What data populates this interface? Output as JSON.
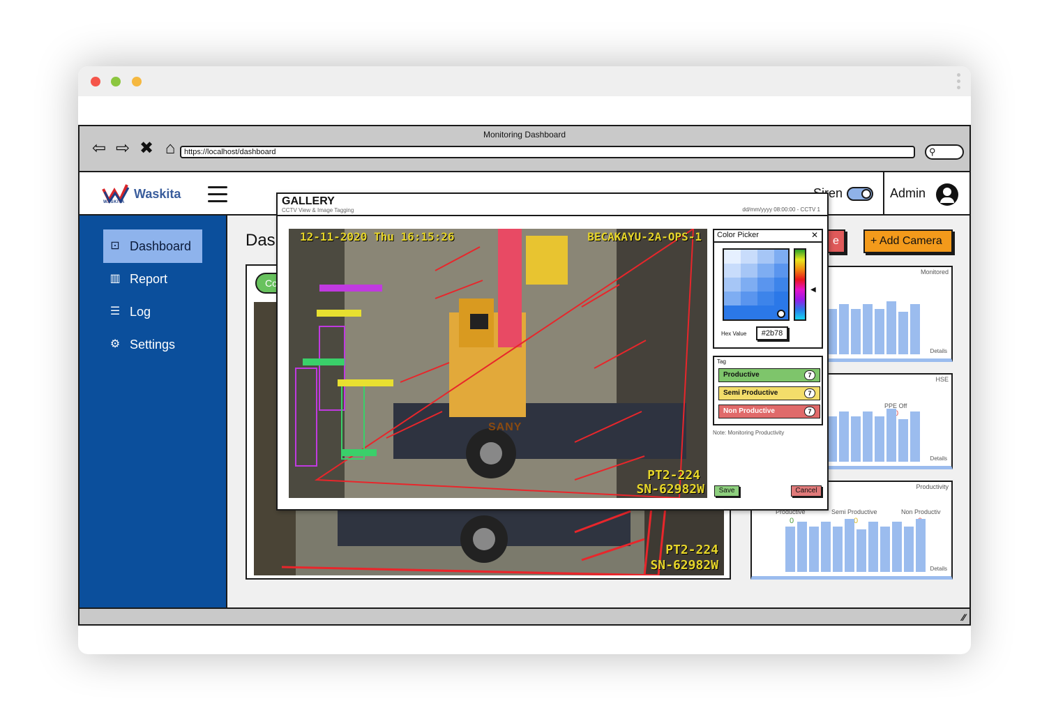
{
  "browser": {
    "window_title": "Monitoring Dashboard",
    "url": "https://localhost/dashboard",
    "nav_icons": [
      "back-icon",
      "forward-icon",
      "close-icon",
      "home-icon"
    ]
  },
  "app": {
    "brand": "Waskita",
    "brand_sub": "WASKITA",
    "siren_label": "Siren",
    "siren_on": true,
    "user": "Admin"
  },
  "sidebar": {
    "items": [
      {
        "label": "Dashboard",
        "icon": "chart-icon",
        "active": true
      },
      {
        "label": "Report",
        "icon": "report-icon",
        "active": false
      },
      {
        "label": "Log",
        "icon": "list-icon",
        "active": false
      },
      {
        "label": "Settings",
        "icon": "gear-icon",
        "active": false
      }
    ]
  },
  "main": {
    "title": "Das",
    "camera_tab_label": "Cc",
    "add_camera_label": "+ Add Camera",
    "red_button_label": "e",
    "camera_osd": {
      "bottom1": "PT2-224",
      "bottom2": "SN-62982W"
    }
  },
  "panels": [
    {
      "title": "Monitored",
      "details": "Details",
      "bars": [
        0.85,
        0.95,
        0.85,
        0.95,
        0.85,
        1.0,
        0.8,
        0.95
      ]
    },
    {
      "title": "HSE",
      "details": "Details",
      "label": "PPE Off",
      "label_value": "0",
      "bars": [
        0.85,
        0.95,
        0.85,
        0.95,
        0.85,
        1.0,
        0.8,
        0.95
      ]
    },
    {
      "title": "Productivity",
      "details": "Details",
      "labels": [
        "Productive",
        "Semi Productive",
        "Non Productiv"
      ],
      "label_values": [
        "0",
        "0",
        "0"
      ],
      "bars": [
        0.85,
        0.95,
        0.85,
        0.95,
        0.85,
        1.0,
        0.8,
        0.95,
        0.85,
        0.95,
        0.85,
        1.0
      ]
    }
  ],
  "modal": {
    "title": "GALLERY",
    "subtitle": "CCTV View & Image Tagging",
    "meta": "dd/mm/yyyy 08:00:00 - CCTV 1",
    "osd_top_left": "12-11-2020 Thu 16:15:26",
    "osd_top_right": "BECAKAYU-2A-OPS-1",
    "osd_bottom1": "PT2-224",
    "osd_bottom2": "SN-62982W",
    "truck_brand": "SANY",
    "color_picker": {
      "title": "Color Picker",
      "hex_label": "Hex Value",
      "hex_value": "#2b78",
      "color": "#2b78e8"
    },
    "tag_title": "Tag",
    "tags": [
      {
        "label": "Productive",
        "count": "7",
        "color": "#7ec56b"
      },
      {
        "label": "Semi Productive",
        "count": "7",
        "color": "#f3dd6a"
      },
      {
        "label": "Non Productive",
        "count": "7",
        "color": "#e06a6a"
      }
    ],
    "note": "Note: Monitoring Productivity",
    "save_label": "Save",
    "cancel_label": "Cancel"
  }
}
